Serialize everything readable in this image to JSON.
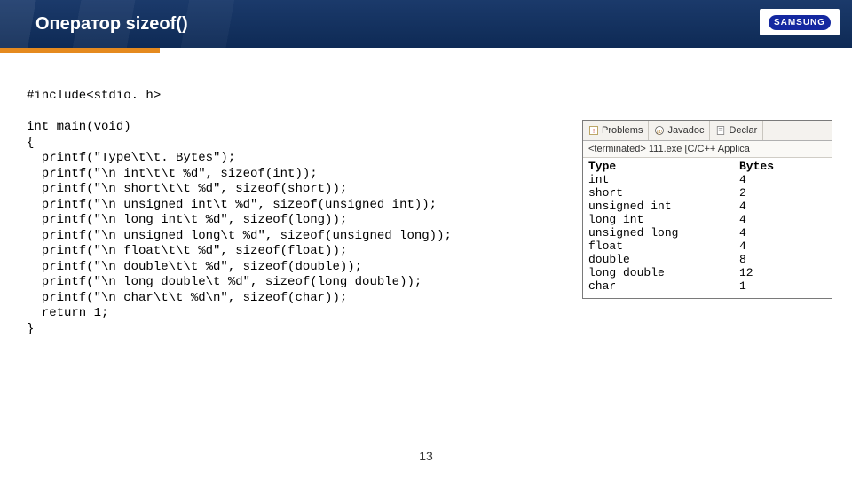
{
  "header": {
    "title": "Оператор sizeof()",
    "logo_text": "SAMSUNG"
  },
  "code_lines": [
    "#include<stdio. h>",
    "",
    "int main(void)",
    "{",
    "  printf(\"Type\\t\\t. Bytes\");",
    "  printf(\"\\n int\\t\\t %d\", sizeof(int));",
    "  printf(\"\\n short\\t\\t %d\", sizeof(short));",
    "  printf(\"\\n unsigned int\\t %d\", sizeof(unsigned int));",
    "  printf(\"\\n long int\\t %d\", sizeof(long));",
    "  printf(\"\\n unsigned long\\t %d\", sizeof(unsigned long));",
    "  printf(\"\\n float\\t\\t %d\", sizeof(float));",
    "  printf(\"\\n double\\t\\t %d\", sizeof(double));",
    "  printf(\"\\n long double\\t %d\", sizeof(long double));",
    "  printf(\"\\n char\\t\\t %d\\n\", sizeof(char));",
    "  return 1;",
    "}"
  ],
  "output_panel": {
    "tabs": [
      {
        "icon": "problems-icon",
        "label": "Problems"
      },
      {
        "icon": "javadoc-icon",
        "label": "Javadoc"
      },
      {
        "icon": "declaration-icon",
        "label": "Declar"
      }
    ],
    "terminated": "<terminated> 111.exe [C/C++ Applica",
    "header": {
      "type": "Type",
      "bytes": "Bytes"
    },
    "rows": [
      {
        "type": "int",
        "bytes": "4"
      },
      {
        "type": "short",
        "bytes": "2"
      },
      {
        "type": "unsigned int",
        "bytes": "4"
      },
      {
        "type": "long int",
        "bytes": "4"
      },
      {
        "type": "unsigned long",
        "bytes": "4"
      },
      {
        "type": "float",
        "bytes": "4"
      },
      {
        "type": "double",
        "bytes": "8"
      },
      {
        "type": "long double",
        "bytes": "12"
      },
      {
        "type": "char",
        "bytes": "1"
      }
    ]
  },
  "page_number": "13"
}
